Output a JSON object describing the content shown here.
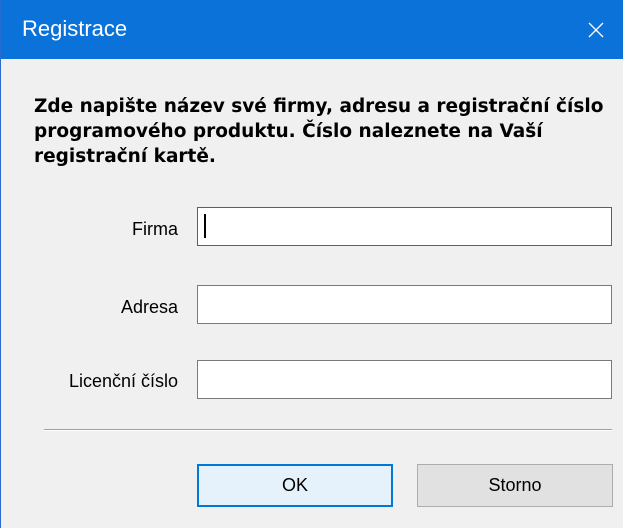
{
  "window": {
    "title": "Registrace",
    "close_icon": "close-icon"
  },
  "instructions": "Zde napište název své firmy, adresu a registrační číslo programového produktu. Číslo naleznete na Vaší registrační kartě.",
  "form": {
    "firma": {
      "label": "Firma",
      "value": ""
    },
    "adresa": {
      "label": "Adresa",
      "value": ""
    },
    "licence": {
      "label": "Licenční číslo",
      "value": ""
    }
  },
  "buttons": {
    "ok": "OK",
    "cancel": "Storno"
  },
  "colors": {
    "titlebar": "#0b72d9",
    "focus_border": "#0078d7",
    "dialog_bg": "#f0f0f0"
  }
}
